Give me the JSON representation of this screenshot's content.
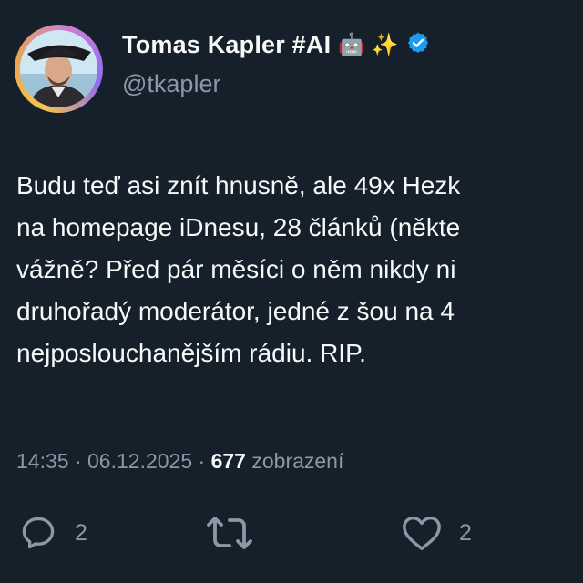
{
  "author": {
    "display_name": "Tomas Kapler #AI",
    "emoji": "🤖 ✨",
    "handle": "@tkapler",
    "verified": true
  },
  "tweet": {
    "lines": [
      "Budu teď asi znít hnusně, ale 49x Hezk",
      "na homepage iDnesu, 28 článků (někte",
      "vážně? Před pár měsíci o něm nikdy ni",
      "druhořadý moderátor, jedné z šou na 4",
      "nejposlouchanějším rádiu. RIP."
    ],
    "time": "14:35",
    "separator": "·",
    "date": "06.12.2025",
    "views_count": "677",
    "views_label": "zobrazení"
  },
  "actions": {
    "replies": "2",
    "likes": "2"
  },
  "icons": {
    "reply": "reply-icon",
    "retweet": "retweet-icon",
    "like": "heart-icon",
    "verified": "verified-badge-icon"
  },
  "colors": {
    "background": "#15202b",
    "text": "#f7f9f9",
    "muted": "#8b98a5",
    "verified": "#1d9bf0"
  }
}
